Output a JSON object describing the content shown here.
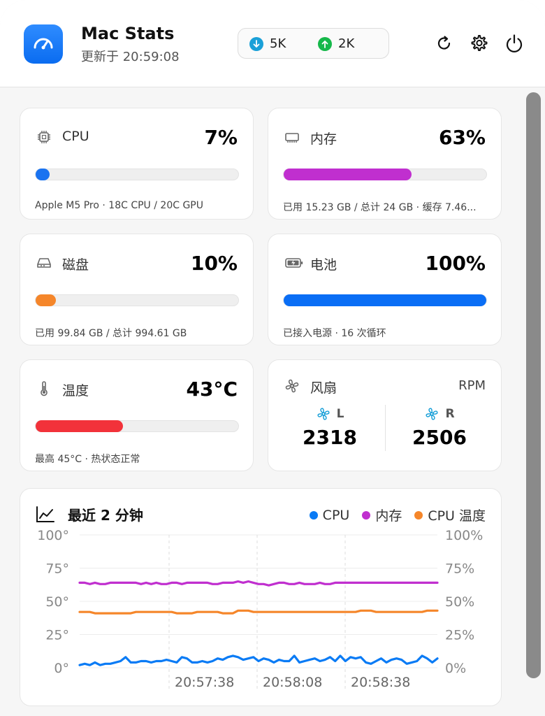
{
  "header": {
    "title": "Mac Stats",
    "subtitle": "更新于 20:59:08",
    "download": "5K",
    "upload": "2K"
  },
  "cards": {
    "cpu": {
      "label": "CPU",
      "value": "7%",
      "percent": 7,
      "detail": "Apple M5 Pro · 18C CPU / 20C GPU",
      "color": "#1a73f0"
    },
    "memory": {
      "label": "内存",
      "value": "63%",
      "percent": 63,
      "detail": "已用 15.23 GB / 总计 24 GB · 缓存 7.46...",
      "color": "#c02fcf"
    },
    "disk": {
      "label": "磁盘",
      "value": "10%",
      "percent": 10,
      "detail": "已用 99.84 GB / 总计 994.61 GB",
      "color": "#f5862a"
    },
    "battery": {
      "label": "电池",
      "value": "100%",
      "percent": 100,
      "detail": "已接入电源 · 16 次循环",
      "color": "#0a6ef5"
    },
    "temperature": {
      "label": "温度",
      "value": "43°C",
      "percent": 43,
      "detail": "最高 45°C · 热状态正常",
      "color": "#f2323a"
    }
  },
  "fan": {
    "label": "风扇",
    "unit": "RPM",
    "left_label": "L",
    "left_value": "2318",
    "right_label": "R",
    "right_value": "2506"
  },
  "chart_data": {
    "type": "line",
    "title": "最近 2 分钟",
    "legend_position": "top-right",
    "left_ticks": [
      "100°",
      "75°",
      "50°",
      "25°",
      "0°"
    ],
    "right_ticks": [
      "100%",
      "75%",
      "50%",
      "25%",
      "0%"
    ],
    "x_ticks": [
      "20:57:38",
      "20:58:08",
      "20:58:38"
    ],
    "ylim": [
      0,
      100
    ],
    "series": [
      {
        "name": "CPU",
        "color": "#0a7bf5",
        "values": [
          2,
          3,
          2,
          4,
          2,
          3,
          3,
          4,
          5,
          8,
          4,
          4,
          5,
          5,
          4,
          5,
          5,
          6,
          5,
          4,
          8,
          7,
          4,
          4,
          5,
          4,
          5,
          7,
          6,
          8,
          9,
          8,
          6,
          7,
          8,
          5,
          7,
          6,
          4,
          6,
          5,
          5,
          9,
          4,
          5,
          6,
          7,
          5,
          6,
          8,
          5,
          9,
          5,
          8,
          7,
          8,
          4,
          3,
          5,
          7,
          4,
          6,
          7,
          6,
          3,
          4,
          5,
          9,
          7,
          4,
          7
        ]
      },
      {
        "name": "内存",
        "color": "#c02fcf",
        "values": [
          64,
          64,
          63,
          64,
          63,
          63,
          64,
          64,
          64,
          64,
          64,
          64,
          63,
          64,
          63,
          64,
          63,
          63,
          64,
          64,
          63,
          64,
          64,
          64,
          64,
          64,
          63,
          63,
          64,
          64,
          64,
          65,
          64,
          65,
          64,
          63,
          63,
          62,
          63,
          64,
          64,
          63,
          63,
          64,
          63,
          63,
          63,
          64,
          63,
          63,
          64,
          64,
          64,
          64,
          64,
          64,
          64,
          64,
          64,
          64,
          64,
          64,
          64,
          64,
          64,
          64,
          64,
          64,
          64,
          64,
          64
        ]
      },
      {
        "name": "CPU 温度",
        "color": "#f5862a",
        "values": [
          42,
          42,
          42,
          41,
          41,
          41,
          41,
          41,
          41,
          41,
          41,
          42,
          42,
          42,
          42,
          42,
          42,
          42,
          42,
          41,
          41,
          41,
          41,
          42,
          42,
          42,
          42,
          42,
          41,
          41,
          41,
          43,
          43,
          43,
          42,
          42,
          42,
          42,
          42,
          42,
          42,
          42,
          42,
          42,
          42,
          42,
          42,
          42,
          42,
          42,
          42,
          42,
          42,
          42,
          42,
          43,
          43,
          43,
          42,
          42,
          42,
          42,
          42,
          42,
          42,
          42,
          42,
          42,
          43,
          43,
          43
        ]
      }
    ]
  }
}
